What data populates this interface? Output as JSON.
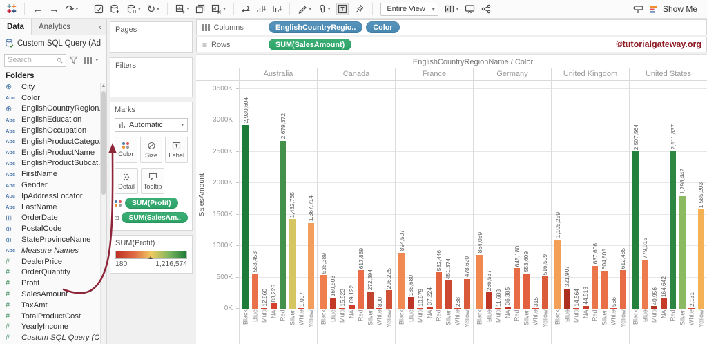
{
  "toolbar": {
    "fit_mode": "Entire View",
    "show_me_label": "Show Me",
    "icons": {
      "back": "←",
      "forward": "→",
      "replay": "↷",
      "refresh": "↻",
      "swap": "⇄",
      "caret": "▾",
      "collapse": "‹",
      "scroll_up": "▲"
    }
  },
  "watermark": "©tutorialgateway.org",
  "sidebar": {
    "tabs": {
      "data": "Data",
      "analytics": "Analytics"
    },
    "datasource": "Custom SQL Query (Adv...",
    "search_placeholder": "Search",
    "folders_label": "Folders",
    "fields": [
      {
        "name": "City",
        "icon": "geo"
      },
      {
        "name": "Color",
        "icon": "str"
      },
      {
        "name": "EnglishCountryRegion...",
        "icon": "geo"
      },
      {
        "name": "EnglishEducation",
        "icon": "str"
      },
      {
        "name": "EnglishOccupation",
        "icon": "str"
      },
      {
        "name": "EnglishProductCatego...",
        "icon": "str"
      },
      {
        "name": "EnglishProductName",
        "icon": "str"
      },
      {
        "name": "EnglishProductSubcat...",
        "icon": "str"
      },
      {
        "name": "FirstName",
        "icon": "str"
      },
      {
        "name": "Gender",
        "icon": "str"
      },
      {
        "name": "IpAddressLocator",
        "icon": "str"
      },
      {
        "name": "LastName",
        "icon": "str"
      },
      {
        "name": "OrderDate",
        "icon": "date"
      },
      {
        "name": "PostalCode",
        "icon": "geo"
      },
      {
        "name": "StateProvinceName",
        "icon": "geo"
      },
      {
        "name": "Measure Names",
        "icon": "str",
        "italic": true
      },
      {
        "name": "DealerPrice",
        "icon": "num"
      },
      {
        "name": "OrderQuantity",
        "icon": "num"
      },
      {
        "name": "Profit",
        "icon": "num"
      },
      {
        "name": "SalesAmount",
        "icon": "num"
      },
      {
        "name": "TaxAmt",
        "icon": "num"
      },
      {
        "name": "TotalProductCost",
        "icon": "num"
      },
      {
        "name": "YearlyIncome",
        "icon": "num"
      },
      {
        "name": "Custom SQL Query (C",
        "icon": "num",
        "italic": true
      }
    ]
  },
  "cards": {
    "pages_label": "Pages",
    "filters_label": "Filters",
    "marks_label": "Marks",
    "marks_type": "Automatic",
    "buttons": {
      "color": "Color",
      "size": "Size",
      "label": "Label",
      "detail": "Detail",
      "tooltip": "Tooltip"
    },
    "mark_pills": [
      "SUM(Profit)",
      "SUM(SalesAm.."
    ]
  },
  "legend": {
    "title": "SUM(Profit)",
    "min": "180",
    "max": "1,216,574"
  },
  "shelves": {
    "columns_label": "Columns",
    "rows_label": "Rows",
    "columns_pills": [
      "EnglishCountryRegio..",
      "Color"
    ],
    "rows_pills": [
      "SUM(SalesAmount)"
    ]
  },
  "chart_data": {
    "type": "bar",
    "title": "EnglishCountryRegionName / Color",
    "ylabel": "SalesAmount",
    "ymax": 3500000,
    "ytick_step": 500000,
    "ytick_labels": [
      "0K",
      "500K",
      "1000K",
      "1500K",
      "2000K",
      "2500K",
      "3000K",
      "3500K"
    ],
    "grid": true,
    "color_categories": [
      "Black",
      "Blue",
      "Multi",
      "NA",
      "Red",
      "Silver",
      "White",
      "Yellow"
    ],
    "color_encoding": {
      "field": "SUM(Profit)",
      "min": 180,
      "max": 1216574,
      "scale": "red-yellow-green"
    },
    "panels": [
      {
        "country": "Australia",
        "values": [
          2930604,
          553453,
          12860,
          83225,
          2679372,
          1432765,
          1007,
          1367714
        ],
        "bar_colors": [
          "#1e7c39",
          "#e8714c",
          "#d6402c",
          "#d4402c",
          "#43914b",
          "#d5c661",
          "#d6402c",
          "#f39e5c"
        ]
      },
      {
        "country": "Canada",
        "values": [
          536389,
          169503,
          15523,
          69122,
          617889,
          272394,
          800,
          296225
        ],
        "bar_colors": [
          "#ef7f4f",
          "#c23a27",
          "#d6402c",
          "#cd3d29",
          "#ea6c49",
          "#c1452e",
          "#d6402c",
          "#d05136"
        ]
      },
      {
        "country": "France",
        "values": [
          894507,
          188680,
          10879,
          37224,
          582446,
          451374,
          288,
          478620
        ],
        "bar_colors": [
          "#f18a52",
          "#bd3526",
          "#d6402c",
          "#c93c29",
          "#e56440",
          "#cc4832",
          "#d6402c",
          "#d85a3b"
        ]
      },
      {
        "country": "Germany",
        "values": [
          864089,
          266537,
          11688,
          36385,
          645180,
          553609,
          315,
          516509
        ],
        "bar_colors": [
          "#f0884f",
          "#c03726",
          "#d6402c",
          "#bd3424",
          "#e76c45",
          "#e2603d",
          "#d6402c",
          "#da5c3a"
        ]
      },
      {
        "country": "United Kingdom",
        "values": [
          1105259,
          321907,
          14564,
          44519,
          687606,
          604805,
          566,
          612485
        ],
        "bar_colors": [
          "#f5a057",
          "#ad2f20",
          "#d6402c",
          "#cb3e2b",
          "#ec764b",
          "#e97047",
          "#d6402c",
          "#e86c45"
        ]
      },
      {
        "country": "United States",
        "values": [
          2507564,
          779015,
          40956,
          164642,
          2511837,
          1798442,
          2131,
          1585203
        ],
        "bar_colors": [
          "#23813c",
          "#ee7b4d",
          "#b03021",
          "#c53b28",
          "#2d8742",
          "#8cba62",
          "#d6402c",
          "#f4b156"
        ]
      }
    ]
  }
}
